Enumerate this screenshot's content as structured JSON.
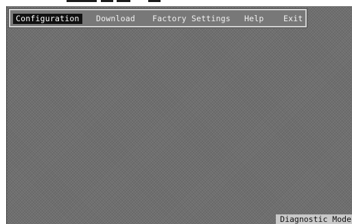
{
  "menu": {
    "items": [
      {
        "label": "Configuration",
        "active": true
      },
      {
        "label": "Download",
        "active": false
      },
      {
        "label": "Factory Settings",
        "active": false
      },
      {
        "label": "Help",
        "active": false
      },
      {
        "label": "Exit",
        "active": false
      }
    ]
  },
  "status": {
    "mode": "Diagnostic Mode"
  },
  "colors": {
    "background": "#6f6f6f",
    "menu_highlight": "#111111",
    "status_bar": "#c9c9c9"
  }
}
